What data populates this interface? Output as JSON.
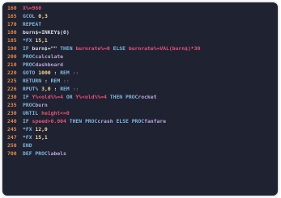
{
  "editor": {
    "lines": [
      {
        "number": "160",
        "tokens": [
          {
            "t": "var",
            "v": "X%=960"
          }
        ]
      },
      {
        "number": "165",
        "tokens": [
          {
            "t": "kw",
            "v": "GCOL "
          },
          {
            "t": "num",
            "v": "0,3"
          }
        ]
      },
      {
        "number": "170",
        "tokens": [
          {
            "t": "kw",
            "v": "REPEAT"
          }
        ]
      },
      {
        "number": "180",
        "tokens": [
          {
            "t": "plain",
            "v": "burn$=INKEY$(0)"
          }
        ]
      },
      {
        "number": "185",
        "tokens": [
          {
            "t": "kw",
            "v": "*FX "
          },
          {
            "t": "num",
            "v": "15,1"
          }
        ]
      },
      {
        "number": "190",
        "tokens": [
          {
            "t": "kw",
            "v": "IF "
          },
          {
            "t": "plain",
            "v": "burn$=\"\" "
          },
          {
            "t": "kw",
            "v": "THEN "
          },
          {
            "t": "var",
            "v": "burnrate%=0 "
          },
          {
            "t": "kw",
            "v": "ELSE "
          },
          {
            "t": "var",
            "v": "burnrate%=VAL(burn$)*30"
          }
        ]
      },
      {
        "number": "200",
        "tokens": [
          {
            "t": "kw",
            "v": "PROC"
          },
          {
            "t": "proc",
            "v": "calculate"
          }
        ]
      },
      {
        "number": "210",
        "tokens": [
          {
            "t": "kw",
            "v": "PROC"
          },
          {
            "t": "proc",
            "v": "dashboard"
          }
        ]
      },
      {
        "number": "220",
        "tokens": [
          {
            "t": "kw",
            "v": "GOTO "
          },
          {
            "t": "num",
            "v": "1000"
          },
          {
            "t": "plain",
            "v": " : "
          },
          {
            "t": "kw",
            "v": "REM "
          },
          {
            "t": "cmt",
            "v": "::"
          }
        ]
      },
      {
        "number": "225",
        "tokens": [
          {
            "t": "kw",
            "v": "RETURN"
          },
          {
            "t": "plain",
            "v": " : "
          },
          {
            "t": "kw",
            "v": "REM "
          },
          {
            "t": "cmt",
            "v": "::"
          }
        ]
      },
      {
        "number": "226",
        "tokens": [
          {
            "t": "kw",
            "v": "RPUT% "
          },
          {
            "t": "num",
            "v": "3,0"
          },
          {
            "t": "plain",
            "v": " : "
          },
          {
            "t": "kw",
            "v": "REM "
          },
          {
            "t": "cmt",
            "v": "::"
          }
        ]
      },
      {
        "number": "230",
        "tokens": [
          {
            "t": "kw",
            "v": "IF "
          },
          {
            "t": "var",
            "v": "Y%<old%%=4 "
          },
          {
            "t": "kw",
            "v": "OR "
          },
          {
            "t": "var",
            "v": "Y%<old%%=4 "
          },
          {
            "t": "kw",
            "v": "THEN PROC"
          },
          {
            "t": "proc",
            "v": "rocket"
          }
        ]
      },
      {
        "number": "235",
        "tokens": [
          {
            "t": "kw",
            "v": "PROC"
          },
          {
            "t": "proc",
            "v": "burn"
          }
        ]
      },
      {
        "number": "230",
        "tokens": [
          {
            "t": "kw",
            "v": "UNTIL "
          },
          {
            "t": "var",
            "v": "height<=0"
          }
        ]
      },
      {
        "number": "240",
        "tokens": [
          {
            "t": "kw",
            "v": "IF "
          },
          {
            "t": "var",
            "v": "speed>0.004 "
          },
          {
            "t": "kw",
            "v": "THEN PROC"
          },
          {
            "t": "proc",
            "v": "crash "
          },
          {
            "t": "kw",
            "v": "ELSE PROC"
          },
          {
            "t": "proc",
            "v": "fanfare"
          }
        ]
      },
      {
        "number": "245",
        "tokens": [
          {
            "t": "kw",
            "v": "*FX "
          },
          {
            "t": "num",
            "v": "12,0"
          }
        ]
      },
      {
        "number": "247",
        "tokens": [
          {
            "t": "kw",
            "v": "*FX "
          },
          {
            "t": "num",
            "v": "15,1"
          }
        ]
      },
      {
        "number": "250",
        "tokens": [
          {
            "t": "kw",
            "v": "END"
          }
        ]
      },
      {
        "number": "700",
        "tokens": [
          {
            "t": "kw",
            "v": "DEF PROC"
          },
          {
            "t": "proc",
            "v": "labels"
          }
        ]
      }
    ]
  },
  "colors": {
    "background": "#1f2230",
    "line_number": "#e58a4a",
    "keyword": "#7fb6e0",
    "variable": "#e0567a",
    "number": "#f0d79a",
    "comment": "#6d5f8a"
  }
}
